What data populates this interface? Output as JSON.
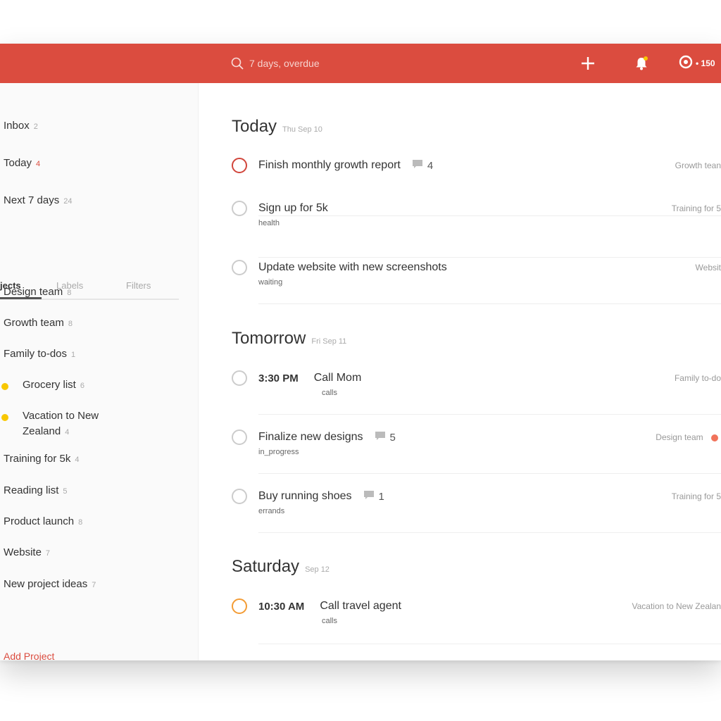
{
  "topbar": {
    "search_placeholder": "7 days, overdue",
    "karma": "• 150",
    "icons": [
      "search-icon",
      "plus-icon",
      "bell-icon",
      "karma-icon"
    ],
    "accent": "#db4c3f"
  },
  "sidebar": {
    "nav": [
      {
        "label": "Inbox",
        "count": "2"
      },
      {
        "label": "Today",
        "count": "4"
      },
      {
        "label": "Next 7 days",
        "count": "24"
      }
    ],
    "tabs": [
      "jects",
      "Labels",
      "Filters"
    ],
    "projects": [
      {
        "label": "Design team",
        "count": "8"
      },
      {
        "label": "Growth team",
        "count": "8"
      },
      {
        "label": "Family to-dos",
        "count": "1"
      },
      {
        "label": "Grocery list",
        "count": "6"
      },
      {
        "label": "Vacation to New",
        "label2": "Zealand",
        "count": "4"
      },
      {
        "label": "Training for 5k",
        "count": "4"
      },
      {
        "label": "Reading list",
        "count": "5"
      },
      {
        "label": "Product launch",
        "count": "8"
      },
      {
        "label": "Website",
        "count": "7"
      },
      {
        "label": "New project ideas",
        "count": "7"
      }
    ],
    "add_project": "Add Project"
  },
  "main": {
    "sections": [
      {
        "title": "Today",
        "date": "Thu Sep 10",
        "tasks": [
          {
            "title": "Finish monthly growth report",
            "comments": "4",
            "label": "",
            "project": "Growth tean",
            "time": ""
          },
          {
            "title": "Sign up for 5k",
            "comments": "",
            "label": "health",
            "project": "Training for 5",
            "time": ""
          },
          {
            "title": "Update website with new screenshots",
            "comments": "",
            "label": "waiting",
            "project": "Websit",
            "time": ""
          }
        ]
      },
      {
        "title": "Tomorrow",
        "date": "Fri Sep 11",
        "tasks": [
          {
            "title": "Call Mom",
            "comments": "",
            "label": "calls",
            "project": "Family to-do",
            "time": "3:30 PM"
          },
          {
            "title": "Finalize new designs",
            "comments": "5",
            "label": "in_progress",
            "project": "Design team",
            "time": ""
          },
          {
            "title": "Buy running shoes",
            "comments": "1",
            "label": "errands",
            "project": "Training for 5",
            "time": ""
          }
        ]
      },
      {
        "title": "Saturday",
        "date": "Sep 12",
        "tasks": [
          {
            "title": "Call travel agent",
            "comments": "",
            "label": "calls",
            "project": "Vacation to New Zealan",
            "time": "10:30 AM"
          }
        ]
      }
    ]
  }
}
